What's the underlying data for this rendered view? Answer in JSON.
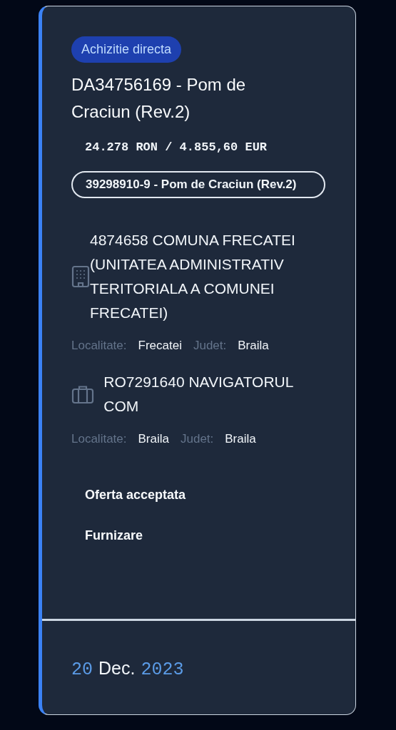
{
  "card": {
    "badge": "Achizitie directa",
    "title": "DA34756169 - Pom de Craciun (Rev.2)",
    "amount": "24.278 RON / 4.855,60 EUR",
    "cpv": "39298910-9 - Pom de Craciun (Rev.2)",
    "parties": [
      {
        "kind": "authority",
        "name": "4874658 COMUNA FRECATEI (UNITATEA ADMINISTRATIV TERITORIALA A COMUNEI FRECATEI)",
        "locality_label": "Localitate:",
        "locality": "Frecatei",
        "county_label": "Judet:",
        "county": "Braila"
      },
      {
        "kind": "supplier",
        "name": "RO7291640 NAVIGATORUL COM",
        "locality_label": "Localitate:",
        "locality": "Braila",
        "county_label": "Judet:",
        "county": "Braila"
      }
    ],
    "status": "Oferta acceptata",
    "contract_type": "Furnizare",
    "date": {
      "day": "20",
      "month": "Dec.",
      "year": "2023"
    }
  }
}
